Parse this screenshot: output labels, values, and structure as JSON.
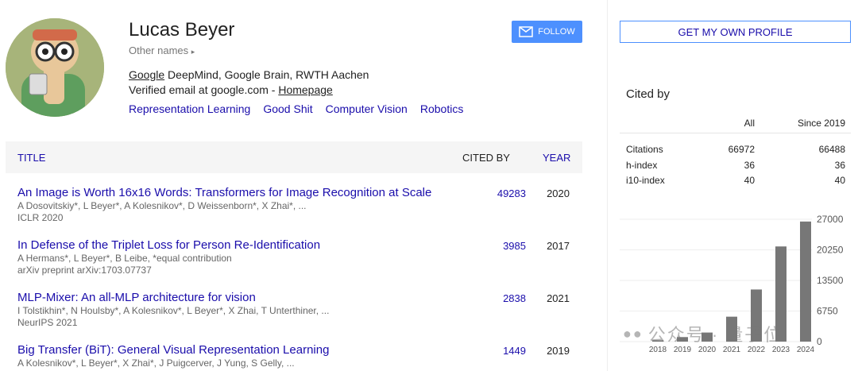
{
  "profile": {
    "name": "Lucas Beyer",
    "other_names": "Other names",
    "affiliation_link": "Google",
    "affiliation_rest": " DeepMind, Google Brain, RWTH Aachen",
    "verified_prefix": "Verified email at google.com - ",
    "homepage_link": "Homepage",
    "interests": [
      "Representation Learning",
      "Good Shit",
      "Computer Vision",
      "Robotics"
    ]
  },
  "actions": {
    "follow_label": "FOLLOW",
    "own_profile_label": "GET MY OWN PROFILE"
  },
  "table": {
    "headers": {
      "title": "TITLE",
      "cited_by": "CITED BY",
      "year": "YEAR"
    },
    "rows": [
      {
        "title": "An Image is Worth 16x16 Words: Transformers for Image Recognition at Scale",
        "authors": "A Dosovitskiy*, L Beyer*, A Kolesnikov*, D Weissenborn*, X Zhai*, ...",
        "venue": "ICLR 2020",
        "cited_by": "49283",
        "year": "2020"
      },
      {
        "title": "In Defense of the Triplet Loss for Person Re-Identification",
        "authors": "A Hermans*, L Beyer*, B Leibe, *equal contribution",
        "venue": "arXiv preprint arXiv:1703.07737",
        "cited_by": "3985",
        "year": "2017"
      },
      {
        "title": "MLP-Mixer: An all-MLP architecture for vision",
        "authors": "I Tolstikhin*, N Houlsby*, A Kolesnikov*, L Beyer*, X Zhai, T Unterthiner, ...",
        "venue": "NeurIPS 2021",
        "cited_by": "2838",
        "year": "2021"
      },
      {
        "title": "Big Transfer (BiT): General Visual Representation Learning",
        "authors": "A Kolesnikov*, L Beyer*, X Zhai*, J Puigcerver, J Yung, S Gelly, ...",
        "venue": "",
        "cited_by": "1449",
        "year": "2019"
      }
    ]
  },
  "citations": {
    "heading": "Cited by",
    "col_all": "All",
    "col_since": "Since 2019",
    "rows": [
      {
        "label": "Citations",
        "all": "66972",
        "since": "66488"
      },
      {
        "label": "h-index",
        "all": "36",
        "since": "36"
      },
      {
        "label": "i10-index",
        "all": "40",
        "since": "40"
      }
    ]
  },
  "chart_data": {
    "type": "bar",
    "categories": [
      "2018",
      "2019",
      "2020",
      "2021",
      "2022",
      "2023",
      "2024"
    ],
    "values": [
      300,
      1000,
      2000,
      5500,
      11500,
      21000,
      26500
    ],
    "yticks": [
      "27000",
      "20250",
      "13500",
      "6750",
      "0"
    ],
    "ylim": [
      0,
      27000
    ],
    "grid": true,
    "title": "",
    "xlabel": "",
    "ylabel": ""
  },
  "watermark": {
    "text": "公众号 · 量子位"
  },
  "colors": {
    "link": "#1a0dab",
    "follow_bg": "#4d90fe",
    "bar": "#777777"
  }
}
